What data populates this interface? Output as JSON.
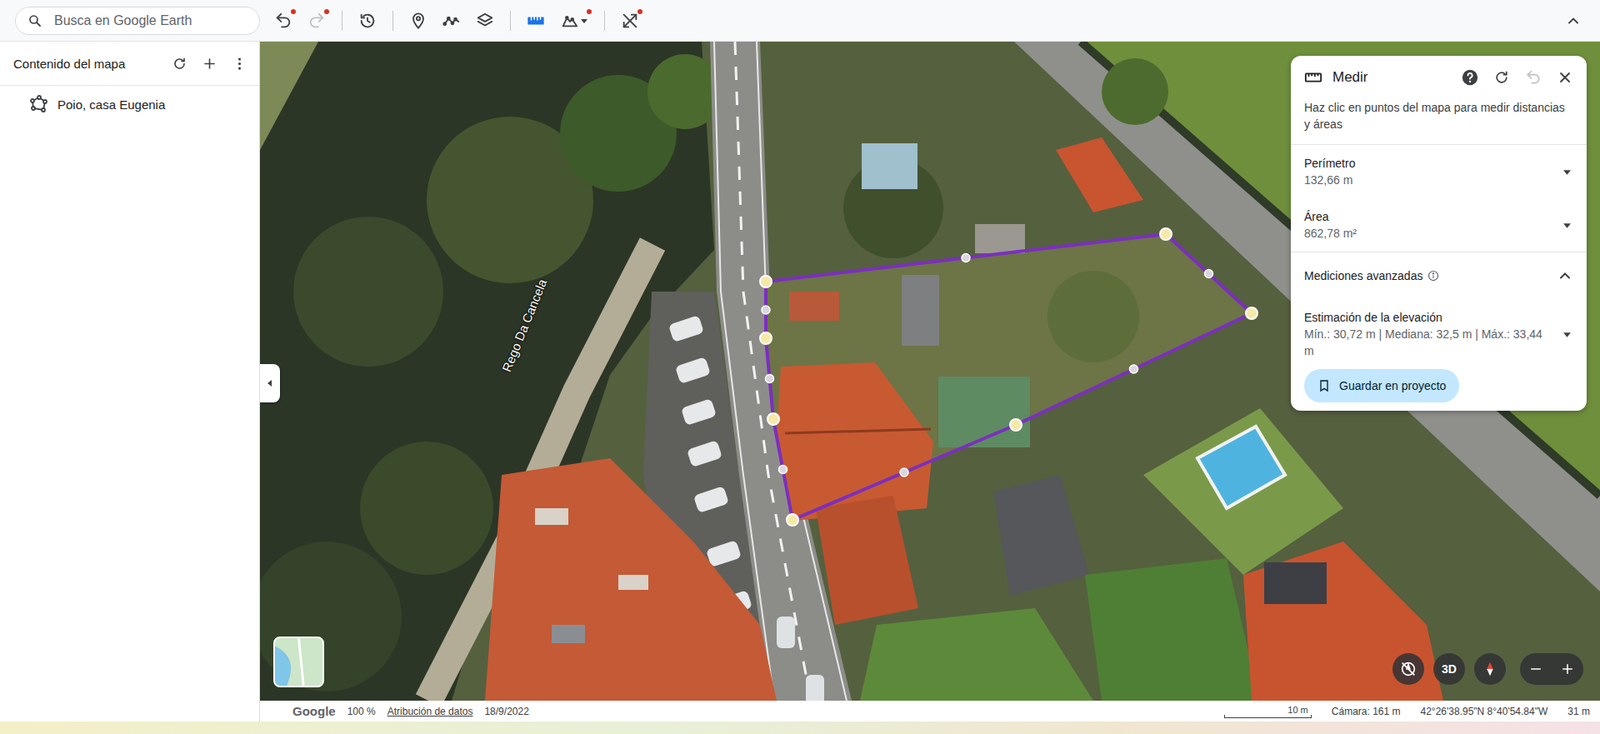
{
  "toolbar": {
    "search": {
      "placeholder": "Busca en Google Earth"
    },
    "tools": [
      {
        "kind": "undo",
        "badge": true,
        "disabled": false,
        "selected": false,
        "dropdown": false
      },
      {
        "kind": "redo",
        "badge": true,
        "disabled": true,
        "selected": false,
        "dropdown": false
      },
      {
        "kind": "separator",
        "badge": false,
        "disabled": false,
        "selected": false,
        "dropdown": false
      },
      {
        "kind": "history",
        "badge": false,
        "disabled": false,
        "selected": false,
        "dropdown": false
      },
      {
        "kind": "separator",
        "badge": false,
        "disabled": false,
        "selected": false,
        "dropdown": false
      },
      {
        "kind": "placemark",
        "badge": false,
        "disabled": false,
        "selected": false,
        "dropdown": false
      },
      {
        "kind": "path",
        "badge": false,
        "disabled": false,
        "selected": false,
        "dropdown": false
      },
      {
        "kind": "layers",
        "badge": false,
        "disabled": false,
        "selected": false,
        "dropdown": false
      },
      {
        "kind": "separator",
        "badge": false,
        "disabled": false,
        "selected": false,
        "dropdown": false
      },
      {
        "kind": "ruler",
        "badge": false,
        "disabled": false,
        "selected": true,
        "dropdown": false
      },
      {
        "kind": "area",
        "badge": true,
        "disabled": false,
        "selected": false,
        "dropdown": true
      },
      {
        "kind": "separator",
        "badge": false,
        "disabled": false,
        "selected": false,
        "dropdown": false
      },
      {
        "kind": "tools",
        "badge": true,
        "disabled": false,
        "selected": false,
        "dropdown": false
      }
    ]
  },
  "sidebar": {
    "title": "Contenido del mapa",
    "items": [
      {
        "label": "Poio, casa Eugenia",
        "selected": false
      }
    ]
  },
  "map": {
    "street_label": "Rego Da Cancela",
    "view_button": "3D"
  },
  "measure_panel": {
    "title": "Medir",
    "undo_disabled": true,
    "hint": "Haz clic en puntos del mapa para medir distancias y áreas",
    "rows": [
      {
        "label": "Perímetro",
        "value": "132,66 m",
        "expanded": false
      },
      {
        "label": "Área",
        "value": "862,78 m²",
        "expanded": false
      }
    ],
    "advanced": {
      "label": "Mediciones avanzadas",
      "expanded": true,
      "rows": [
        {
          "label": "Estimación de la elevación",
          "value": "Mín.: 30,72 m | Mediana: 32,5 m | Máx.: 33,44 m",
          "expanded": false
        }
      ]
    },
    "save_button": "Guardar en proyecto"
  },
  "status_bar": {
    "brand": "Google",
    "zoom": "100 %",
    "attribution": "Atribución de datos",
    "date": "18/9/2022",
    "scale": "10 m",
    "camera": "Cámara: 161 m",
    "coordinates": "42°26'38.95\"N 8°40'54.84\"W",
    "elevation": "31 m"
  }
}
